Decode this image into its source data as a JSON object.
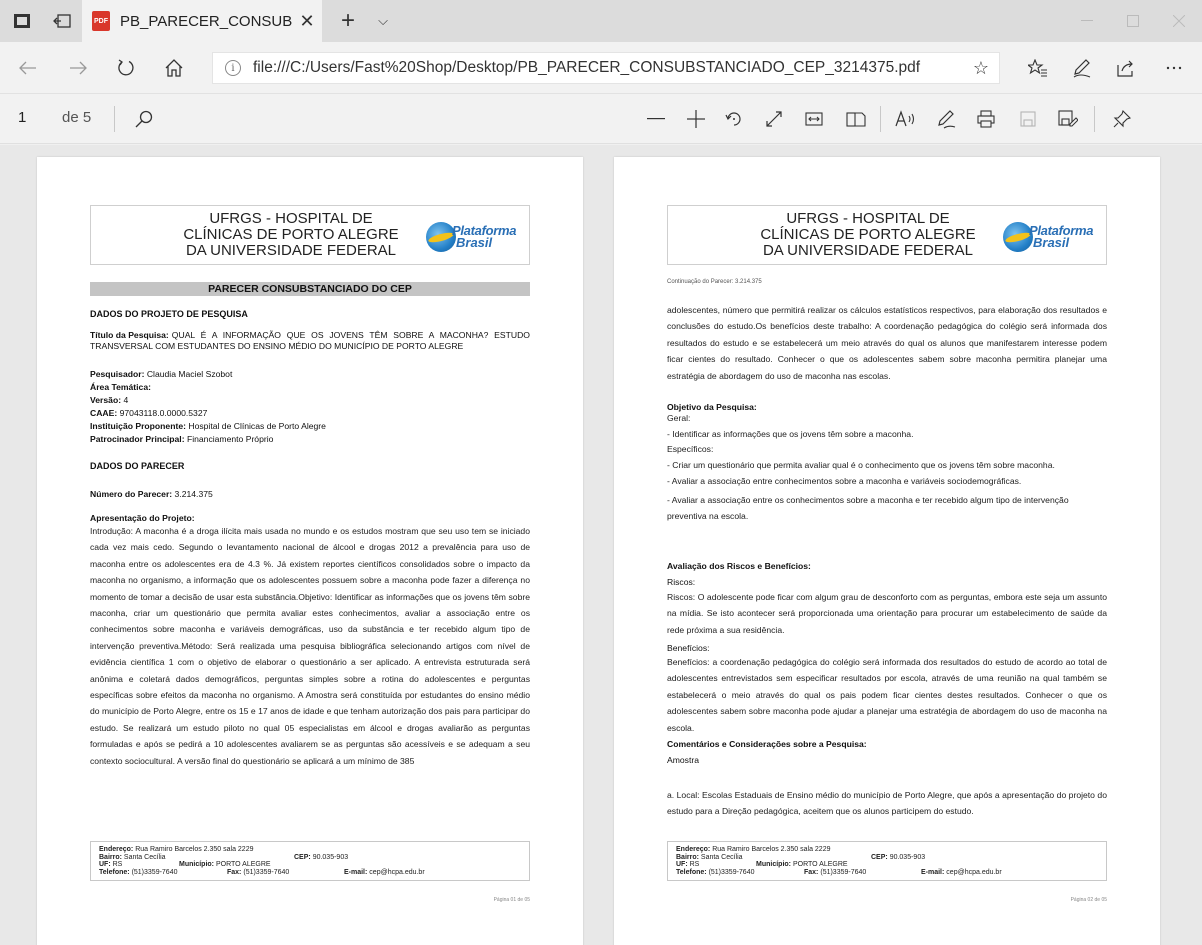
{
  "browser": {
    "tab_title": "PB_PARECER_CONSUBS",
    "tab_close": "✕",
    "new_tab": "+",
    "tab_list": "⌵",
    "url": "file:///C:/Users/Fast%20Shop/Desktop/PB_PARECER_CONSUBSTANCIADO_CEP_3214375.pdf"
  },
  "pdf_toolbar": {
    "page_number": "1",
    "page_of": "de 5"
  },
  "page1": {
    "header_lines": [
      "UFRGS - HOSPITAL DE",
      "CLÍNICAS DE PORTO ALEGRE",
      "DA UNIVERSIDADE FEDERAL"
    ],
    "logo_line1": "Plataforma",
    "logo_line2": "Brasil",
    "band_title": "PARECER CONSUBSTANCIADO DO CEP",
    "section_projeto": "DADOS DO PROJETO DE PESQUISA",
    "titulo_label": "Título da Pesquisa:",
    "titulo_value": "QUAL É A INFORMAÇÃO QUE OS JOVENS TÊM SOBRE A MACONHA? ESTUDO TRANSVERSAL COM ESTUDANTES DO ENSINO MÉDIO DO MUNICÍPIO DE PORTO ALEGRE",
    "pesquisador_label": "Pesquisador:",
    "pesquisador_value": "Claudia Maciel Szobot",
    "area_label": "Área Temática:",
    "versao_label": "Versão:",
    "versao_value": "4",
    "caae_label": "CAAE:",
    "caae_value": "97043118.0.0000.5327",
    "instituicao_label": "Instituição Proponente:",
    "instituicao_value": "Hospital de Clínicas de Porto Alegre",
    "patrocinador_label": "Patrocinador Principal:",
    "patrocinador_value": "Financiamento Próprio",
    "section_parecer": "DADOS DO PARECER",
    "numero_label": "Número do Parecer:",
    "numero_value": "3.214.375",
    "apresentacao_title": "Apresentação do Projeto:",
    "apresentacao_text": "Introdução: A maconha é a droga ilícita mais usada no mundo e os estudos mostram que seu uso tem se iniciado cada vez mais cedo. Segundo o levantamento nacional de álcool e drogas 2012 a prevalência para uso de maconha entre os adolescentes era de 4.3 %. Já existem reportes científicos consolidados sobre o impacto da maconha no organismo, a informação que os adolescentes possuem sobre a maconha pode fazer a diferença no momento de tomar a decisão de usar esta substância.Objetivo: Identificar as informações que os jovens têm sobre maconha, criar um questionário que permita avaliar estes conhecimentos, avaliar a associação entre os conhecimentos sobre maconha e variáveis demográficas, uso da substância e ter recebido algum tipo de intervenção preventiva.Método: Será realizada uma pesquisa bibliográfica selecionando artigos com nível de evidência científica 1 com o objetivo de elaborar o questionário a ser aplicado. A entrevista estruturada será anônima e coletará dados demográficos, perguntas simples sobre a rotina do adolescentes e perguntas específicas sobre efeitos da maconha no organismo. A Amostra será constituída por estudantes do ensino médio do município de Porto Alegre, entre os 15 e 17 anos de idade e que tenham autorização dos pais para participar do estudo. Se realizará um estudo piloto no qual 05 especialistas em álcool e drogas avaliarão as perguntas formuladas e após se pedirá a 10 adolescentes avaliarem se as perguntas são acessíveis e se adequam a seu contexto sociocultural. A versão final do questionário se aplicará a um mínimo de 385",
    "footer": {
      "endereco_label": "Endereço:",
      "endereco_value": "Rua Ramiro Barcelos 2.350 sala 2229",
      "bairro_label": "Bairro:",
      "bairro_value": "Santa Cecília",
      "cep_label": "CEP:",
      "cep_value": "90.035-903",
      "uf_label": "UF:",
      "uf_value": "RS",
      "municipio_label": "Município:",
      "municipio_value": "PORTO ALEGRE",
      "telefone_label": "Telefone:",
      "telefone_value": "(51)3359-7640",
      "fax_label": "Fax:",
      "fax_value": "(51)3359-7640",
      "email_label": "E-mail:",
      "email_value": "cep@hcpa.edu.br"
    },
    "page_label": "Página 01 de 05"
  },
  "page2": {
    "header_lines": [
      "UFRGS - HOSPITAL DE",
      "CLÍNICAS DE PORTO ALEGRE",
      "DA UNIVERSIDADE FEDERAL"
    ],
    "logo_line1": "Plataforma",
    "logo_line2": "Brasil",
    "continuation": "Continuação do Parecer: 3.214.375",
    "intro_text": "adolescentes, número que permitirá realizar os cálculos estatísticos respectivos, para elaboração dos resultados e conclusões do estudo.Os benefícios deste trabalho: A coordenação pedagógica do colégio será informada dos resultados do estudo e se estabelecerá um meio através do qual os alunos que manifestarem interesse podem ficar cientes do resultado. Conhecer o que os adolescentes sabem sobre maconha permitira planejar uma estratégia de abordagem do uso de maconha nas escolas.",
    "objetivo_title": "Objetivo da Pesquisa:",
    "objetivo_lines": [
      "Geral:",
      "- Identificar as informações que os jovens têm sobre a maconha.",
      "Específicos:",
      "- Criar um questionário que permita avaliar qual é o conhecimento que os jovens têm sobre maconha.",
      "- Avaliar a associação entre conhecimentos sobre a maconha e variáveis sociodemográficas.",
      "- Avaliar a associação entre os conhecimentos sobre a maconha e ter recebido algum tipo de intervenção preventiva na escola."
    ],
    "avaliacao_title": "Avaliação dos Riscos e Benefícios:",
    "riscos_label": "Riscos:",
    "riscos_text": "Riscos: O adolescente pode ficar com algum grau de desconforto com as perguntas, embora este seja um assunto na mídia. Se isto acontecer será proporcionada uma orientação para procurar um estabelecimento de saúde da rede próxima a sua residência.",
    "beneficios_label": "Benefícios:",
    "beneficios_text": "Benefícios: a coordenação pedagógica do colégio será informada dos resultados do estudo de acordo ao total de adolescentes entrevistados sem especificar resultados por escola, através de uma reunião na qual também se estabelecerá o meio através do qual os pais podem ficar cientes destes resultados. Conhecer o que os adolescentes sabem sobre maconha pode ajudar a planejar uma estratégia de abordagem do uso de maconha na escola.",
    "comentarios_title": "Comentários e Considerações sobre a Pesquisa:",
    "amostra_label": "Amostra",
    "local_text": "a. Local: Escolas Estaduais de Ensino médio do município de Porto Alegre, que após a apresentação do projeto do estudo para a Direção pedagógica, aceitem que os alunos participem do estudo.",
    "footer": {
      "endereco_label": "Endereço:",
      "endereco_value": "Rua Ramiro Barcelos 2.350 sala 2229",
      "bairro_label": "Bairro:",
      "bairro_value": "Santa Cecília",
      "cep_label": "CEP:",
      "cep_value": "90.035-903",
      "uf_label": "UF:",
      "uf_value": "RS",
      "municipio_label": "Município:",
      "municipio_value": "PORTO ALEGRE",
      "telefone_label": "Telefone:",
      "telefone_value": "(51)3359-7640",
      "fax_label": "Fax:",
      "fax_value": "(51)3359-7640",
      "email_label": "E-mail:",
      "email_value": "cep@hcpa.edu.br"
    },
    "page_label": "Página 02 de 05"
  }
}
